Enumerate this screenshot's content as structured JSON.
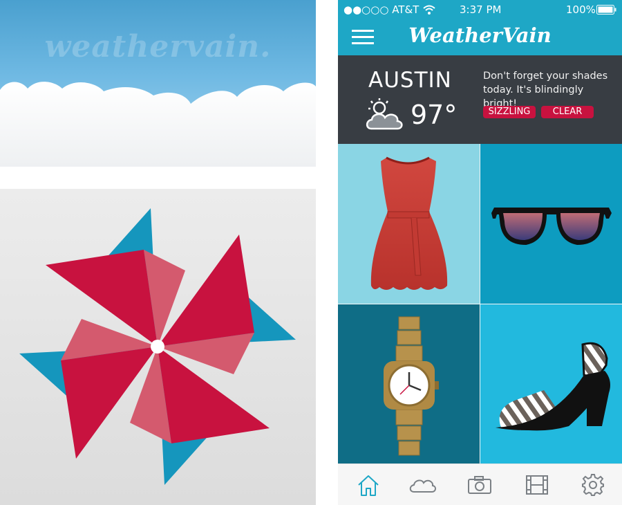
{
  "splash": {
    "brand": "weathervain."
  },
  "status_bar": {
    "carrier": "●●○○○ AT&T",
    "time": "3:37 PM",
    "battery": "100%"
  },
  "header": {
    "title": "WeatherVain",
    "menu_icon": "hamburger-menu-icon"
  },
  "weather": {
    "city": "AUSTIN",
    "temperature": "97°",
    "condition_icon": "partly-cloudy-icon",
    "message": "Don't forget your shades today. It's blindingly bright!",
    "tags": [
      "SIZZLING",
      "CLEAR"
    ]
  },
  "outfit_tiles": [
    {
      "item": "dress",
      "icon": "red-dress-icon"
    },
    {
      "item": "sunglasses",
      "icon": "sunglasses-icon"
    },
    {
      "item": "watch",
      "icon": "gold-watch-icon"
    },
    {
      "item": "heel",
      "icon": "high-heel-icon"
    }
  ],
  "tab_bar": [
    {
      "name": "home",
      "icon": "home-icon",
      "active": true
    },
    {
      "name": "weather",
      "icon": "cloud-icon",
      "active": false
    },
    {
      "name": "camera",
      "icon": "camera-icon",
      "active": false
    },
    {
      "name": "video",
      "icon": "film-icon",
      "active": false
    },
    {
      "name": "settings",
      "icon": "gear-icon",
      "active": false
    }
  ],
  "colors": {
    "accent": "#1ea7c6",
    "tag_red": "#c8123f",
    "dark_panel": "#383d43",
    "pinwheel_red": "#c8123f",
    "pinwheel_blue": "#1596bd"
  }
}
